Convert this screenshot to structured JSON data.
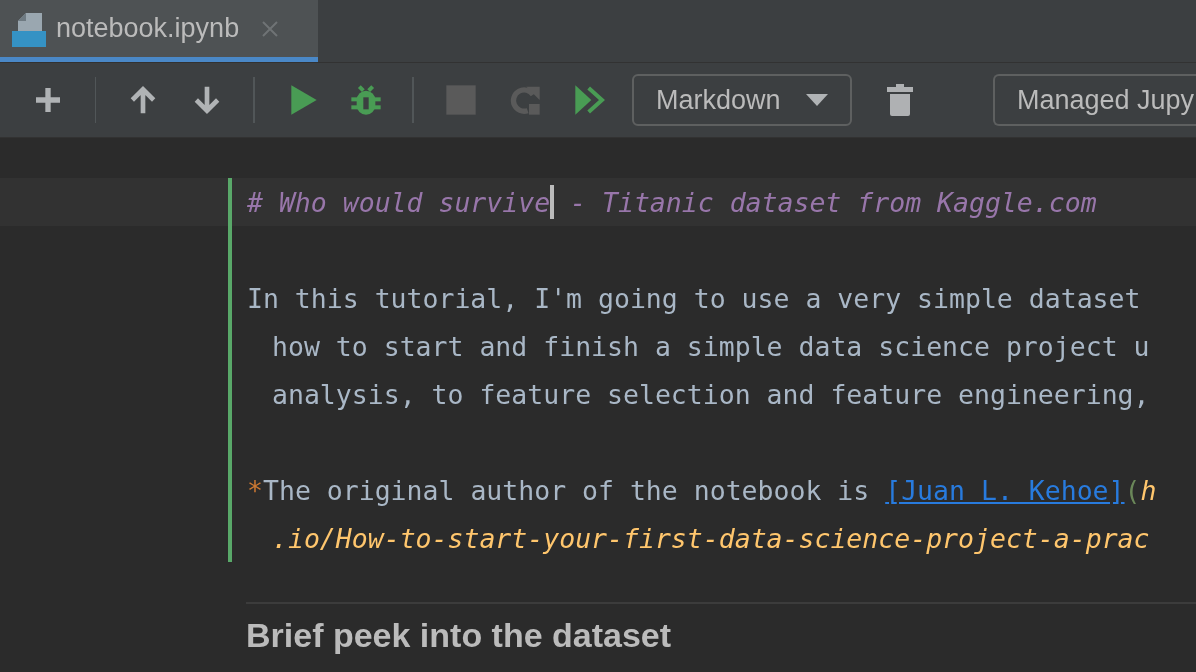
{
  "tabs": [
    {
      "label": "notebook.ipynb",
      "selected": true
    }
  ],
  "toolbar": {
    "buttons": [
      {
        "kind": "add",
        "disabled": false
      },
      {
        "kind": "separator"
      },
      {
        "kind": "up",
        "disabled": false
      },
      {
        "kind": "down",
        "disabled": false
      },
      {
        "kind": "separator"
      },
      {
        "kind": "run",
        "disabled": false
      },
      {
        "kind": "debug",
        "disabled": false
      },
      {
        "kind": "separator"
      },
      {
        "kind": "stop",
        "disabled": true
      },
      {
        "kind": "restart",
        "disabled": true
      },
      {
        "kind": "run_all",
        "disabled": false
      }
    ],
    "cell_type": "Markdown",
    "kernel": "Managed Jupy"
  },
  "editor": {
    "lines": [
      {
        "current": true,
        "segments": [
          {
            "kind": "header",
            "text": "# Who would survive"
          },
          {
            "kind": "cursor"
          },
          {
            "kind": "header",
            "text": " - Titanic dataset from Kaggle.com"
          }
        ]
      },
      {
        "kind": "blank"
      },
      {
        "segments": [
          {
            "kind": "plain",
            "text": "In this tutorial, I'm going to use a very simple dataset"
          }
        ]
      },
      {
        "wrapped": true,
        "segments": [
          {
            "kind": "plain",
            "text": "how to start and finish a simple data science project u"
          }
        ]
      },
      {
        "wrapped": true,
        "segments": [
          {
            "kind": "plain",
            "text": "analysis, to feature selection and feature engineering,"
          }
        ]
      },
      {
        "kind": "blank"
      },
      {
        "segments": [
          {
            "kind": "emphasis",
            "text": "*"
          },
          {
            "kind": "plain",
            "text": "The original author of the notebook is "
          },
          {
            "kind": "link",
            "text": "[Juan L. Kehoe]"
          },
          {
            "kind": "paren",
            "text": "("
          },
          {
            "kind": "url",
            "text": "h"
          }
        ]
      },
      {
        "wrapped": true,
        "segments": [
          {
            "kind": "url",
            "text": ".io/How-to-start-your-first-data-science-project-a-prac"
          }
        ]
      }
    ]
  },
  "rendered": {
    "heading": "Brief peek into the dataset"
  }
}
